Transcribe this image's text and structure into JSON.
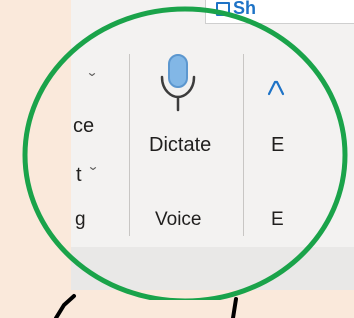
{
  "ribbon": {
    "top": {
      "share_label": "Sh"
    },
    "left_group": {
      "item_1": "ce",
      "item_2": "t",
      "group_label": "g"
    },
    "voice": {
      "button_label": "Dictate",
      "group_label": "Voice"
    },
    "right_group": {
      "button_label": "E",
      "group_label": "E"
    }
  },
  "icons": {
    "share": "share-icon",
    "microphone": "microphone-icon",
    "chevron": "chevron-down-icon"
  },
  "colors": {
    "background": "#fae9db",
    "ribbon": "#f3f2f1",
    "ring": "#1aa34a",
    "mic_blue": "#82b7e6",
    "text": "#201f1e",
    "accent_blue": "#1e73c6"
  }
}
